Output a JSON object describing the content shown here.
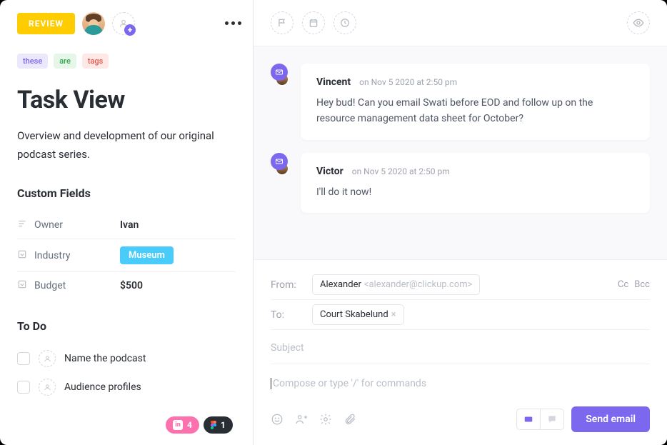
{
  "header": {
    "status": "REVIEW"
  },
  "tags": {
    "t0": "these",
    "t1": "are",
    "t2": "tags"
  },
  "task": {
    "title": "Task View",
    "description": "Overview and development of our original podcast series."
  },
  "customFields": {
    "heading": "Custom Fields",
    "owner_label": "Owner",
    "owner_value": "Ivan",
    "industry_label": "Industry",
    "industry_value": "Museum",
    "budget_label": "Budget",
    "budget_value": "$500"
  },
  "todo": {
    "heading": "To Do",
    "items": {
      "i0": "Name the podcast",
      "i1": "Audience profiles"
    }
  },
  "pills": {
    "invision_count": "4",
    "figma_count": "1"
  },
  "thread": {
    "m0": {
      "name": "Vincent",
      "time": "on Nov 5 2020 at 2:50 pm",
      "body": "Hey bud! Can you email Swati before EOD and follow up on the resource management data sheet for October?"
    },
    "m1": {
      "name": "Victor",
      "time": "on Nov 5 2020 at 2:50 pm",
      "body": "I'll do it now!"
    }
  },
  "compose": {
    "from_label": "From:",
    "from_name": "Alexander",
    "from_email": "<alexander@clickup.com>",
    "to_label": "To:",
    "to_name": "Court Skabelund",
    "cc": "Cc",
    "bcc": "Bcc",
    "subject_placeholder": "Subject",
    "editor_placeholder": "Compose or type '/' for commands",
    "send_button": "Send email"
  }
}
